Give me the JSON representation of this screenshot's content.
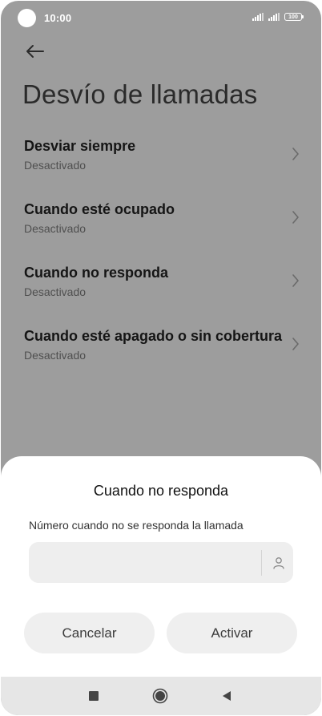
{
  "status_bar": {
    "time": "10:00",
    "battery_level": "100",
    "icons": [
      "signal-icon",
      "signal-icon",
      "battery-icon"
    ]
  },
  "header": {
    "back_icon": "arrow-left-icon",
    "title": "Desvío de llamadas"
  },
  "settings": {
    "items": [
      {
        "title": "Desviar siempre",
        "status": "Desactivado"
      },
      {
        "title": "Cuando esté ocupado",
        "status": "Desactivado"
      },
      {
        "title": "Cuando no responda",
        "status": "Desactivado"
      },
      {
        "title": "Cuando esté apagado o sin cobertura",
        "status": "Desactivado"
      }
    ],
    "chevron_icon": "chevron-right-icon"
  },
  "dialog": {
    "title": "Cuando no responda",
    "field_label": "Número cuando no se responda la llamada",
    "field_value": "",
    "contact_icon": "person-icon",
    "cancel_label": "Cancelar",
    "activate_label": "Activar"
  },
  "nav_bar": {
    "icons": [
      "square-recents-icon",
      "circle-home-icon",
      "triangle-back-icon"
    ]
  },
  "colors": {
    "overlay_background": "#9d9d9d",
    "sheet_background": "#ffffff",
    "button_background": "#efefef",
    "field_background": "#eeeeee",
    "nav_background": "#e6e6e6"
  }
}
